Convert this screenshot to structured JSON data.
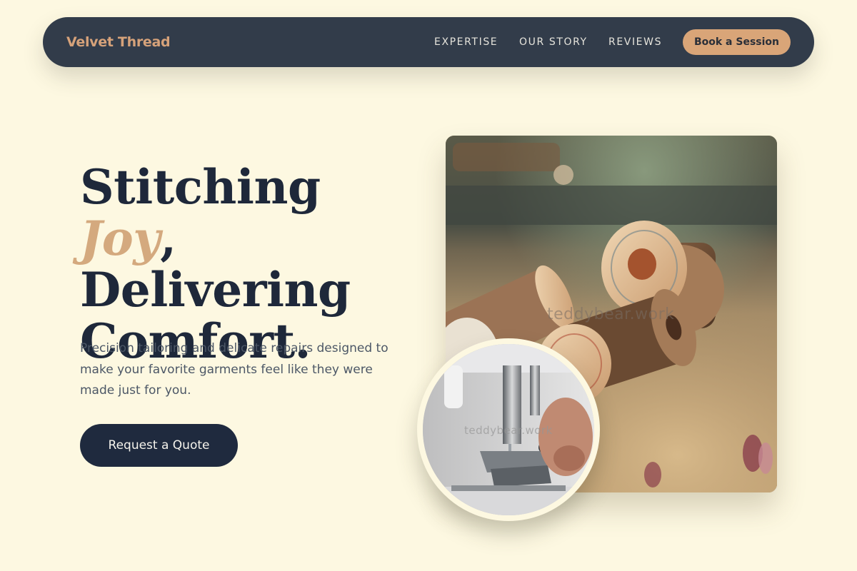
{
  "nav": {
    "brand": "Velvet Thread",
    "links": [
      "EXPERTISE",
      "OUR STORY",
      "REVIEWS"
    ],
    "cta": "Book a Session"
  },
  "hero": {
    "headline_part1": "Stitching ",
    "headline_accent": "Joy",
    "headline_part2": ",",
    "headline_line2": "Delivering",
    "headline_line3": "Comfort.",
    "lead": "Precision tailoring and delicate repairs designed to make your favorite garments feel like they were made just for you.",
    "cta": "Request a Quote"
  },
  "images": {
    "main_photo": "thread-spools-photo",
    "inset_photo": "sewing-machine-photo",
    "watermark": "teddybear.work"
  },
  "colors": {
    "background": "#fdf8e1",
    "nav_bg": "#323c4a",
    "accent": "#d9a578",
    "dark": "#1f2a3e"
  }
}
